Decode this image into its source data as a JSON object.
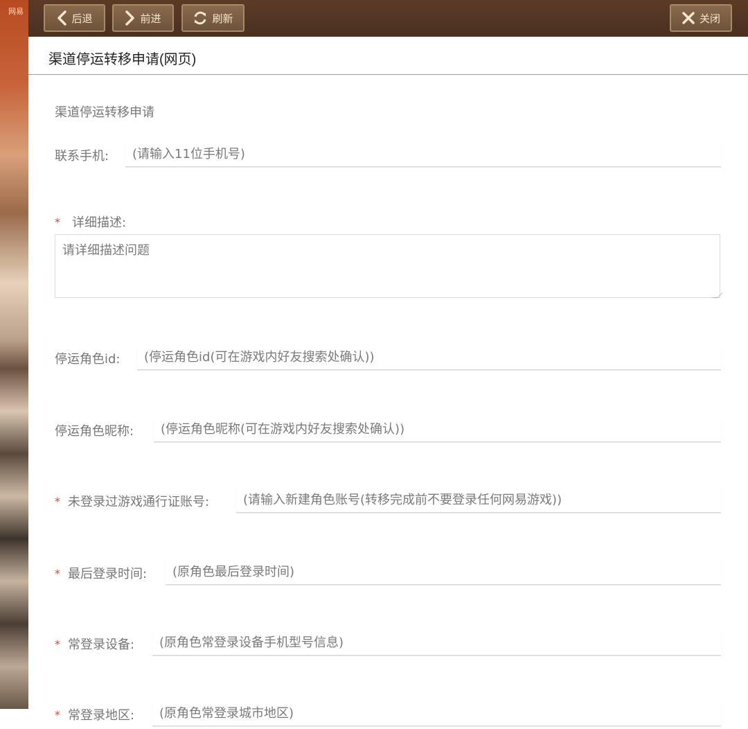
{
  "side": {
    "logo_text": "网易"
  },
  "toolbar": {
    "back_label": "后退",
    "forward_label": "前进",
    "refresh_label": "刷新",
    "close_label": "关闭"
  },
  "header": {
    "title": "渠道停运转移申请(网页)"
  },
  "form": {
    "heading": "渠道停运转移申请",
    "phone": {
      "label": "联系手机:",
      "placeholder": "(请输入11位手机号)",
      "required": false
    },
    "description": {
      "label": "详细描述:",
      "placeholder": "请详细描述问题",
      "required": true
    },
    "role_id": {
      "label": "停运角色id:",
      "placeholder": "(停运角色id(可在游戏内好友搜索处确认))",
      "required": false
    },
    "role_nickname": {
      "label": "停运角色昵称:",
      "placeholder": "(停运角色昵称(可在游戏内好友搜索处确认))",
      "required": false
    },
    "account": {
      "label": "未登录过游戏通行证账号:",
      "placeholder": "(请输入新建角色账号(转移完成前不要登录任何网易游戏))",
      "required": true
    },
    "last_login": {
      "label": "最后登录时间:",
      "placeholder": "(原角色最后登录时间)",
      "required": true
    },
    "device": {
      "label": "常登录设备:",
      "placeholder": "(原角色常登录设备手机型号信息)",
      "required": true
    },
    "region": {
      "label": "常登录地区:",
      "placeholder": "(原角色常登录城市地区)",
      "required": true
    }
  },
  "colors": {
    "required_star": "#d9453a",
    "toolbar_bg": "#4b3020",
    "button_bg": "#6e533a"
  },
  "icons": [
    "chevron-left-icon",
    "chevron-right-icon",
    "refresh-icon",
    "close-icon"
  ]
}
